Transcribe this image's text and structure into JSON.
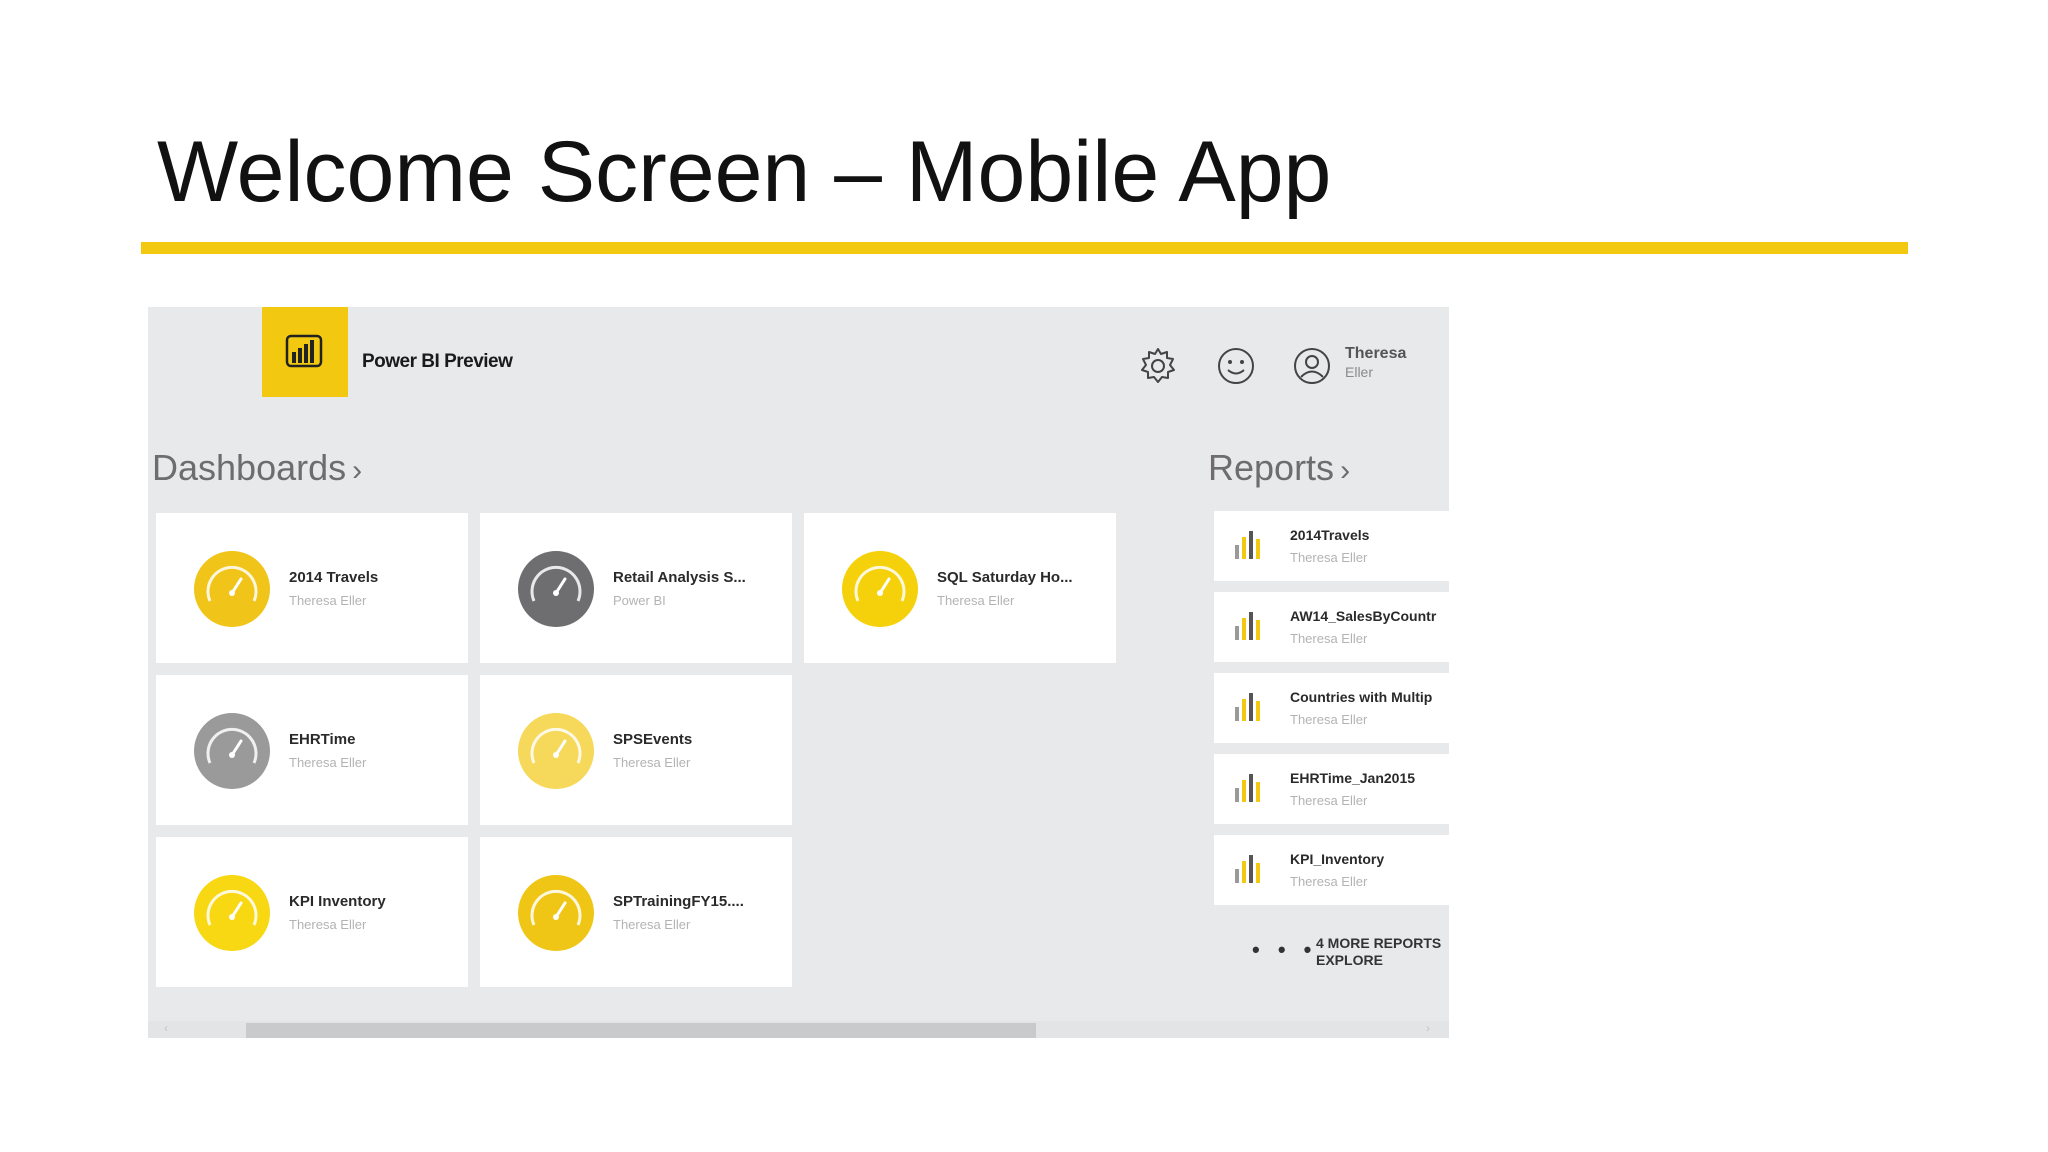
{
  "slide": {
    "title": "Welcome Screen – Mobile App"
  },
  "app": {
    "name": "Power BI Preview",
    "user": {
      "first": "Theresa",
      "last": "Eller"
    },
    "icons": [
      "powerbi-logo-icon",
      "gear-icon",
      "smiley-icon",
      "user-icon"
    ]
  },
  "dashboards": {
    "header": "Dashboards",
    "chevron": "›",
    "tiles": [
      {
        "title": "2014 Travels",
        "owner": "Theresa Eller",
        "color": "#f0c419"
      },
      {
        "title": "Retail Analysis S...",
        "owner": "Power BI",
        "color": "#6e6e70"
      },
      {
        "title": "SQL Saturday Ho...",
        "owner": "Theresa Eller",
        "color": "#f5d10b"
      },
      {
        "title": "EHRTime",
        "owner": "Theresa Eller",
        "color": "#9a9a9b"
      },
      {
        "title": "SPSEvents",
        "owner": "Theresa Eller",
        "color": "#f6d85a"
      },
      {
        "title": "KPI Inventory",
        "owner": "Theresa Eller",
        "color": "#f7d812"
      },
      {
        "title": "SPTrainingFY15....",
        "owner": "Theresa Eller",
        "color": "#efc616"
      }
    ]
  },
  "reports": {
    "header": "Reports",
    "chevron": "›",
    "items": [
      {
        "title": "2014Travels",
        "owner": "Theresa Eller"
      },
      {
        "title": "AW14_SalesByCountr",
        "owner": "Theresa Eller"
      },
      {
        "title": "Countries with Multip",
        "owner": "Theresa Eller"
      },
      {
        "title": "EHRTime_Jan2015",
        "owner": "Theresa Eller"
      },
      {
        "title": "KPI_Inventory",
        "owner": "Theresa Eller"
      }
    ],
    "more_dots": "• • •",
    "more_line1": "4 MORE REPORTS",
    "more_line2": "EXPLORE"
  },
  "colors": {
    "accent": "#f2c811",
    "background": "#e8e9ea"
  }
}
